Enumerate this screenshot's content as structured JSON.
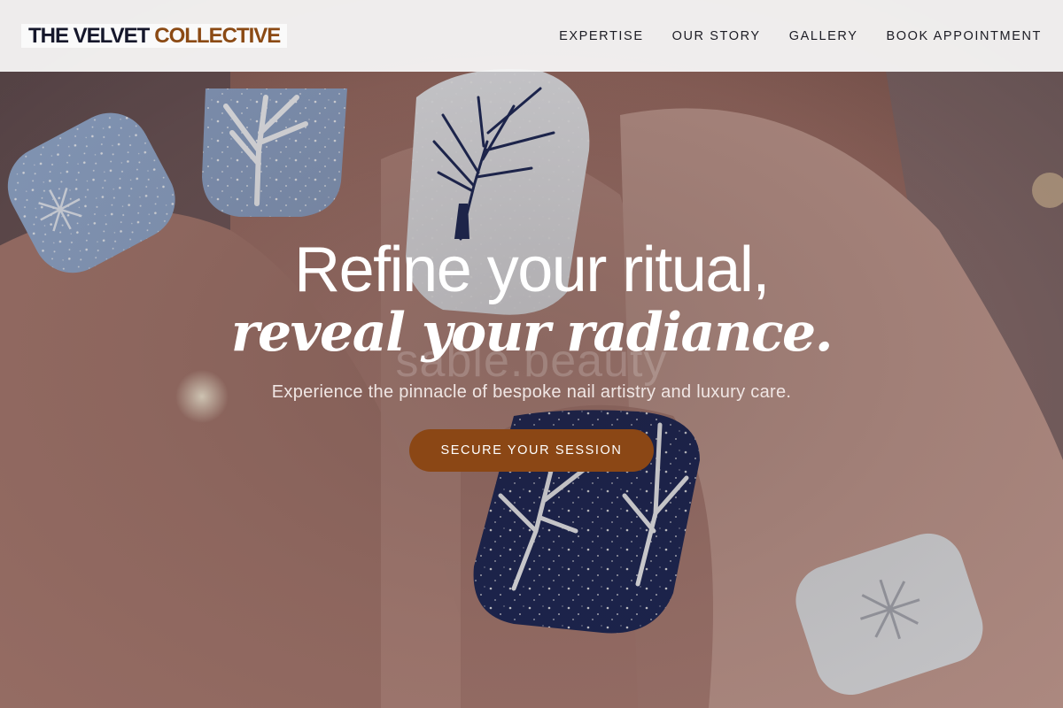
{
  "brand": {
    "part1": "THE VELVET",
    "part2": "COLLECTIVE"
  },
  "nav": {
    "items": [
      {
        "label": "EXPERTISE"
      },
      {
        "label": "OUR STORY"
      },
      {
        "label": "GALLERY"
      },
      {
        "label": "BOOK APPOINTMENT"
      }
    ]
  },
  "hero": {
    "headline_line1": "Refine your ritual,",
    "headline_line2": "reveal your radiance.",
    "watermark": "sable.beauty",
    "subtitle": "Experience the pinnacle of bespoke nail artistry and luxury care.",
    "cta_label": "SECURE YOUR SESSION",
    "background_image": "close-up of hand with winter tree nail art"
  },
  "colors": {
    "brand_dark": "#15172b",
    "brand_accent": "#8b4a14",
    "cta_bg": "#8b4715",
    "nav_bg": "#f5f5f6",
    "nail_navy": "#1f2b5a",
    "nail_blue": "#9bb2d3",
    "nail_white": "#e8e8ea"
  }
}
